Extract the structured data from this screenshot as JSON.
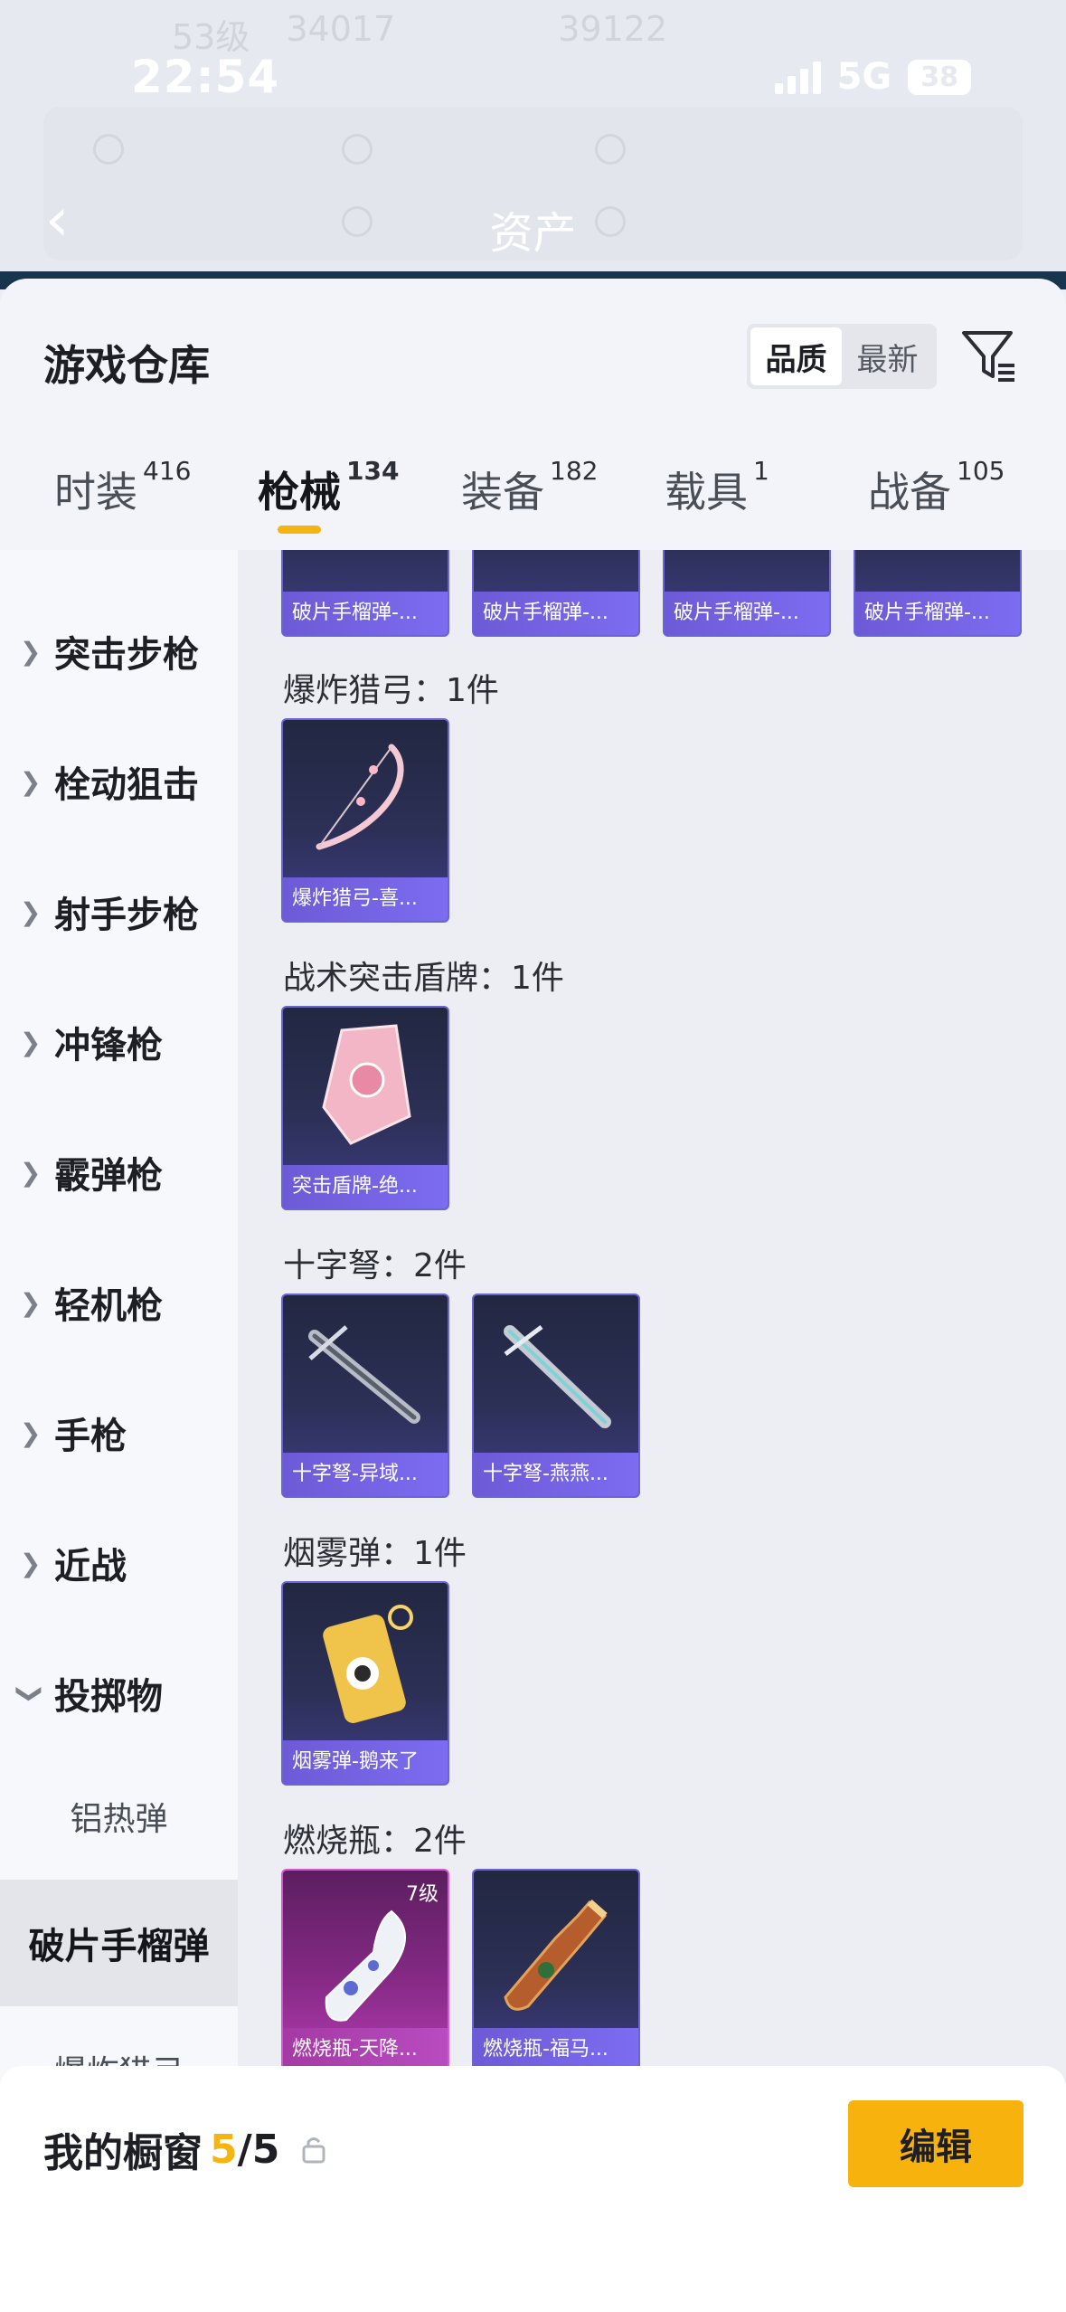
{
  "status_bar": {
    "time": "22:54",
    "network": "5G",
    "battery": "38"
  },
  "background_page": {
    "title": "资产",
    "top_stats": [
      "53级",
      "34017",
      "39122"
    ]
  },
  "sheet": {
    "title": "游戏仓库",
    "sort_options": [
      {
        "label": "品质",
        "active": true
      },
      {
        "label": "最新",
        "active": false
      }
    ]
  },
  "tabs": [
    {
      "label": "时装",
      "count": "416",
      "active": false
    },
    {
      "label": "枪械",
      "count": "134",
      "active": true
    },
    {
      "label": "装备",
      "count": "182",
      "active": false
    },
    {
      "label": "载具",
      "count": "1",
      "active": false
    },
    {
      "label": "战备",
      "count": "105",
      "active": false
    }
  ],
  "sidebar": {
    "categories": [
      "突击步枪",
      "栓动狙击",
      "射手步枪",
      "冲锋枪",
      "霰弹枪",
      "轻机枪",
      "手枪",
      "近战",
      "投掷物"
    ],
    "expanded": "投掷物",
    "subitems": [
      "铝热弹",
      "破片手榴弹",
      "爆炸猎弓"
    ],
    "active_subitem": "破片手榴弹"
  },
  "content": {
    "top_row_captions": [
      "破片手榴弹-...",
      "破片手榴弹-...",
      "破片手榴弹-...",
      "破片手榴弹-..."
    ],
    "groups": [
      {
        "title": "爆炸猎弓：1件",
        "items": [
          {
            "caption": "爆炸猎弓-喜...",
            "icon": "bow-icon"
          }
        ]
      },
      {
        "title": "战术突击盾牌：1件",
        "items": [
          {
            "caption": "突击盾牌-绝...",
            "icon": "shield-icon"
          }
        ]
      },
      {
        "title": "十字弩：2件",
        "items": [
          {
            "caption": "十字弩-异域...",
            "icon": "crossbow-icon"
          },
          {
            "caption": "十字弩-燕燕...",
            "icon": "crossbow-icon"
          }
        ]
      },
      {
        "title": "烟雾弹：1件",
        "items": [
          {
            "caption": "烟雾弹-鹅来了",
            "icon": "smoke-grenade-icon"
          }
        ]
      },
      {
        "title": "燃烧瓶：2件",
        "items": [
          {
            "caption": "燃烧瓶-天降...",
            "icon": "molotov-icon",
            "tier": "7级",
            "rarity": "pink"
          },
          {
            "caption": "燃烧瓶-福马...",
            "icon": "molotov-icon"
          }
        ]
      }
    ]
  },
  "bottom_bar": {
    "label": "我的橱窗",
    "count": "5",
    "total": "/5",
    "edit_label": "编辑"
  },
  "colors": {
    "accent": "#f8b20e",
    "card_purple": "#6c63d8",
    "card_pink": "#b43bb4"
  }
}
